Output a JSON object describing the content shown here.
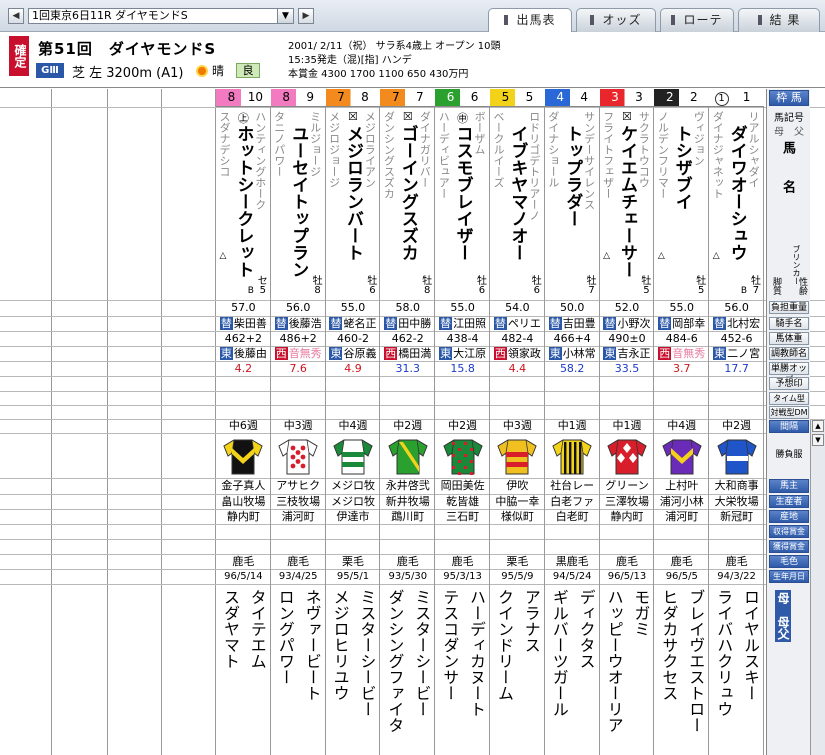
{
  "race_select": {
    "value": "1回東京6日11R ダイヤモンドS"
  },
  "tabs": [
    {
      "label": "出馬表",
      "active": true
    },
    {
      "label": "オッズ",
      "active": false
    },
    {
      "label": "ローテ",
      "active": false
    },
    {
      "label": "結 果",
      "active": false
    }
  ],
  "race": {
    "status": "確定",
    "name": "第51回　ダイヤモンドS",
    "grade": "GⅢ",
    "course": "芝 左 3200m (A1)",
    "weather": "晴",
    "going": "良",
    "line1": "2001/ 2/11（祝） サラ系4歳上 オープン 10頭",
    "line2": "15:35発走（混)[指] ハンデ",
    "line3": "本賞金 4300 1700 1100 650 430万円"
  },
  "labels": {
    "waku": "枠 馬",
    "umakigou": "馬記号",
    "parents": "母　父",
    "bamei": "馬　　名",
    "blinker": "ブリンカー",
    "kyakushitsu": "脚質",
    "sexage": "性齢",
    "kinryo": "負担重量",
    "jockey": "騎手名",
    "weight": "馬体重",
    "trainer": "調教師名",
    "odds": "単勝オッズ",
    "yoso": "予想印",
    "timedm": "タイム型DM",
    "taisendm": "対戦型DM",
    "interval": "間隔",
    "shobufuku": "勝負服",
    "owner": "馬主",
    "breeder": "生産者",
    "sanchi": "産地",
    "shukaku": "収得賞金",
    "kakutoku": "獲得賞金",
    "keiro": "毛色",
    "birthday": "生年月日",
    "bofu": "母　母父"
  },
  "horses": [
    {
      "waku": "1",
      "num": "1",
      "name": "ダイワオーシュウ",
      "sire": "リアルシャダイ",
      "dam": "ダイナジャネット",
      "mark": "",
      "kyaku": "△",
      "sex": "牡",
      "age": "7",
      "blinker": "B",
      "kinryo": "56.0",
      "jockey_mark": "替",
      "jockey": "北村宏",
      "weight": "452-6",
      "trainer_area": "東",
      "trainer": "二ノ宮",
      "odds": "17.7",
      "interval": "中2週",
      "owner": "大和商事",
      "breeder": "大栄牧場",
      "sanchi": "新冠町",
      "color": "鹿毛",
      "birthday": "94/3/22",
      "damdam": "ロイヤルスキー",
      "damsire": "ライバハクリュウ",
      "silk": {
        "body": "#1f55c9",
        "sleeve": "#1f55c9",
        "pattern": "stripe",
        "accent": "#ffffff"
      }
    },
    {
      "waku": "2",
      "num": "2",
      "name": "トシザブイ",
      "sire": "ヴィジョン",
      "dam": "ノルデンフリマー",
      "mark": "",
      "kyaku": "△",
      "sex": "牡",
      "age": "5",
      "blinker": "",
      "kinryo": "55.0",
      "jockey_mark": "替",
      "jockey": "岡部幸",
      "weight": "484-6",
      "trainer_area": "西",
      "trainer": "音無秀",
      "odds": "3.7",
      "interval": "中4週",
      "owner": "上村叶",
      "breeder": "浦河小林",
      "sanchi": "浦河町",
      "color": "鹿毛",
      "birthday": "96/5/5",
      "damdam": "ブレイヴエストロー",
      "damsire": "ヒダカサクセス",
      "silk": {
        "body": "#6a2bb8",
        "sleeve": "#6a2bb8",
        "pattern": "chevron",
        "accent": "#f4d21a"
      }
    },
    {
      "waku": "3",
      "num": "3",
      "name": "ケイエムチェーサー",
      "sire": "サクラトウコウ",
      "dam": "フライトフェザー",
      "mark": "☒",
      "kyaku": "△",
      "sex": "牡",
      "age": "5",
      "blinker": "",
      "kinryo": "52.0",
      "jockey_mark": "替",
      "jockey": "小野次",
      "weight": "490±0",
      "trainer_area": "東",
      "trainer": "吉永正",
      "odds": "33.5",
      "interval": "中1週",
      "owner": "グリーン",
      "breeder": "三澤牧場",
      "sanchi": "静内町",
      "color": "鹿毛",
      "birthday": "96/5/13",
      "damdam": "モガミ",
      "damsire": "ハッピーウオーリア",
      "silk": {
        "body": "#d81e2a",
        "sleeve": "#d81e2a",
        "pattern": "diamond",
        "accent": "#ffffff"
      }
    },
    {
      "waku": "4",
      "num": "4",
      "name": "トップラダー",
      "sire": "サンデーサイレンス",
      "dam": "ダイナショール",
      "mark": "",
      "kyaku": "",
      "sex": "牡",
      "age": "7",
      "blinker": "",
      "kinryo": "50.0",
      "jockey_mark": "替",
      "jockey": "吉田豊",
      "weight": "466+4",
      "trainer_area": "東",
      "trainer": "小林常",
      "odds": "58.2",
      "interval": "中1週",
      "owner": "社台レー",
      "breeder": "白老ファ",
      "sanchi": "白老町",
      "color": "黒鹿毛",
      "birthday": "94/5/24",
      "damdam": "ディクタス",
      "damsire": "ギルバーツガール",
      "silk": {
        "body": "#f3d21a",
        "sleeve": "#f3d21a",
        "pattern": "vstripe",
        "accent": "#111111"
      }
    },
    {
      "waku": "5",
      "num": "5",
      "name": "イブキヤマノオー",
      "sire": "ロドリゴデトリアーノ",
      "dam": "ベークルイーズ",
      "mark": "",
      "kyaku": "",
      "sex": "牡",
      "age": "6",
      "blinker": "",
      "kinryo": "54.0",
      "jockey_mark": "替",
      "jockey": "ペリエ",
      "weight": "482-4",
      "trainer_area": "西",
      "trainer": "領家政",
      "odds": "4.4",
      "interval": "中3週",
      "owner": "伊吹",
      "breeder": "中脇一幸",
      "sanchi": "様似町",
      "color": "栗毛",
      "birthday": "95/5/9",
      "damdam": "アラナス",
      "damsire": "クインドリーム",
      "silk": {
        "body": "#f0c020",
        "sleeve": "#f0c020",
        "pattern": "hoop",
        "accent": "#d81e2a"
      }
    },
    {
      "waku": "6",
      "num": "6",
      "name": "コスモブレイザー",
      "sire": "ボーザム",
      "dam": "ハーディビュアー",
      "mark": "㊥",
      "kyaku": "",
      "sex": "牡",
      "age": "6",
      "blinker": "",
      "kinryo": "55.0",
      "jockey_mark": "替",
      "jockey": "江田照",
      "weight": "438-4",
      "trainer_area": "東",
      "trainer": "大江原",
      "odds": "15.8",
      "interval": "中2週",
      "owner": "岡田美佐",
      "breeder": "乾皆雄",
      "sanchi": "三石町",
      "color": "鹿毛",
      "birthday": "95/3/13",
      "damdam": "ハーディカヌート",
      "damsire": "テスコダンサー",
      "silk": {
        "body": "#1a8a3a",
        "sleeve": "#1a8a3a",
        "pattern": "check",
        "accent": "#d81e2a"
      }
    },
    {
      "waku": "7",
      "num": "7",
      "name": "ゴーイングスズカ",
      "sire": "ダイナガリバー",
      "dam": "ダンシングスズカ",
      "mark": "☒",
      "kyaku": "",
      "sex": "牡",
      "age": "8",
      "blinker": "",
      "kinryo": "58.0",
      "jockey_mark": "替",
      "jockey": "田中勝",
      "weight": "462-2",
      "trainer_area": "西",
      "trainer": "橋田満",
      "odds": "31.3",
      "interval": "中2週",
      "owner": "永井啓弐",
      "breeder": "新井牧場",
      "sanchi": "鵡川町",
      "color": "鹿毛",
      "birthday": "93/5/30",
      "damdam": "ミスターシービー",
      "damsire": "ダンシングファイタ",
      "silk": {
        "body": "#2aa12e",
        "sleeve": "#2aa12e",
        "pattern": "sash",
        "accent": "#f3d21a"
      }
    },
    {
      "waku": "7",
      "num": "8",
      "name": "メジロランバート",
      "sire": "メジロライアン",
      "dam": "メジロジョージ",
      "mark": "☒",
      "kyaku": "",
      "sex": "牡",
      "age": "6",
      "blinker": "",
      "kinryo": "55.0",
      "jockey_mark": "替",
      "jockey": "蛯名正",
      "weight": "460-2",
      "trainer_area": "東",
      "trainer": "谷原義",
      "odds": "4.9",
      "interval": "中4週",
      "owner": "メジロ牧",
      "breeder": "メジロ牧",
      "sanchi": "伊達市",
      "color": "栗毛",
      "birthday": "95/5/1",
      "damdam": "ミスターシービー",
      "damsire": "メジロヒリユウ",
      "silk": {
        "body": "#ffffff",
        "sleeve": "#1a8a3a",
        "pattern": "hoop",
        "accent": "#1a8a3a"
      }
    },
    {
      "waku": "8",
      "num": "9",
      "name": "ユーセイトップラン",
      "sire": "ミルジョージ",
      "dam": "タニノパワー",
      "mark": "",
      "kyaku": "",
      "sex": "牡",
      "age": "8",
      "blinker": "",
      "kinryo": "56.0",
      "jockey_mark": "替",
      "jockey": "後藤浩",
      "weight": "486+2",
      "trainer_area": "西",
      "trainer": "音無秀",
      "odds": "7.6",
      "interval": "中3週",
      "owner": "アサヒク",
      "breeder": "三枝牧場",
      "sanchi": "浦河町",
      "color": "鹿毛",
      "birthday": "93/4/25",
      "damdam": "ネヴァービート",
      "damsire": "ロングパワー",
      "silk": {
        "body": "#ffffff",
        "sleeve": "#ffffff",
        "pattern": "dots",
        "accent": "#d81e2a"
      }
    },
    {
      "waku": "8",
      "num": "10",
      "name": "ホットシークレット",
      "sire": "ハンティングホーク",
      "dam": "スダナデシコ",
      "mark": "㊤",
      "kyaku": "△",
      "sex": "セ",
      "age": "5",
      "blinker": "B",
      "kinryo": "57.0",
      "jockey_mark": "替",
      "jockey": "柴田善",
      "weight": "462+2",
      "trainer_area": "東",
      "trainer": "後藤由",
      "odds": "4.2",
      "interval": "中6週",
      "owner": "金子真人",
      "breeder": "畠山牧場",
      "sanchi": "静内町",
      "color": "鹿毛",
      "birthday": "96/5/14",
      "damdam": "タイテエム",
      "damsire": "スダヤマト",
      "silk": {
        "body": "#111111",
        "sleeve": "#f3d21a",
        "pattern": "chevron",
        "accent": "#f3d21a"
      }
    }
  ],
  "waku_colors": {
    "1": "#ffffff",
    "2": "#222222",
    "3": "#e8262c",
    "4": "#2a68d8",
    "5": "#f3d21a",
    "6": "#2aa12e",
    "7": "#f28a1e",
    "8": "#f27ac0"
  }
}
